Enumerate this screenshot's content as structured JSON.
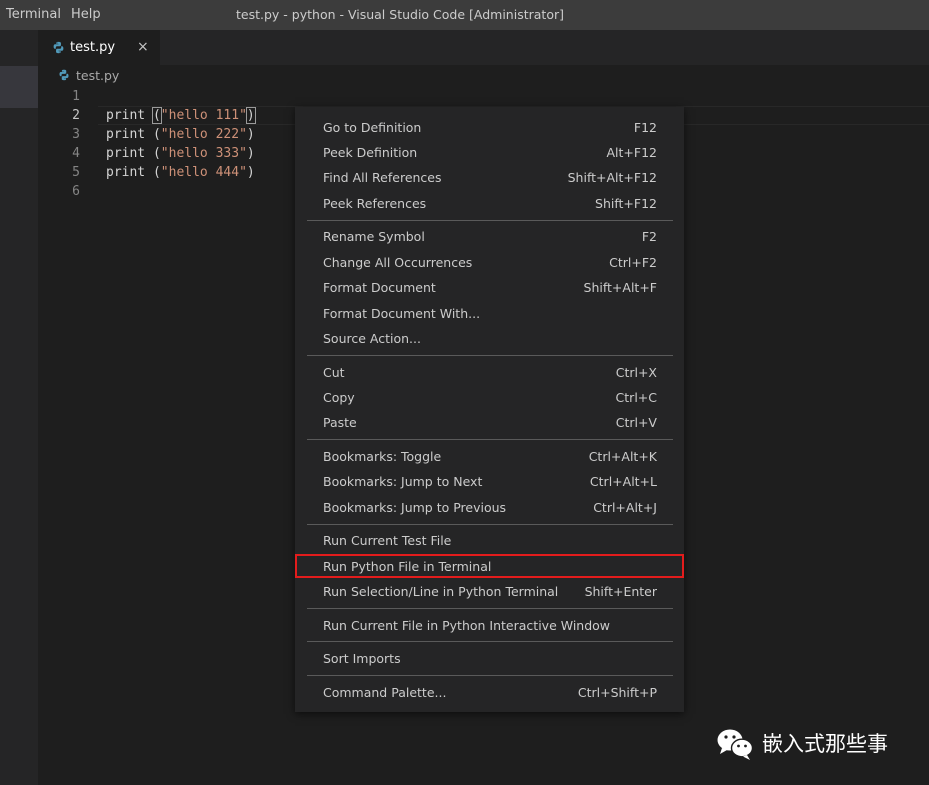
{
  "titlebar": {
    "menus": [
      "Terminal",
      "Help"
    ],
    "window_title": "test.py - python - Visual Studio Code [Administrator]"
  },
  "tab": {
    "label": "test.py",
    "close_glyph": "×",
    "icon": "python-file-icon"
  },
  "breadcrumb": {
    "label": "test.py",
    "icon": "python-file-icon"
  },
  "editor": {
    "line_numbers": [
      "1",
      "2",
      "3",
      "4",
      "5",
      "6"
    ],
    "lines": [
      {
        "fn": "",
        "str": ""
      },
      {
        "fn": "print",
        "str": "\"hello 111\""
      },
      {
        "fn": "print",
        "str": "\"hello 222\""
      },
      {
        "fn": "print",
        "str": "\"hello 333\""
      },
      {
        "fn": "print",
        "str": "\"hello 444\""
      },
      {
        "fn": "",
        "str": ""
      }
    ]
  },
  "context_menu": {
    "items": [
      {
        "label": "Go to Definition",
        "key": "F12"
      },
      {
        "label": "Peek Definition",
        "key": "Alt+F12"
      },
      {
        "label": "Find All References",
        "key": "Shift+Alt+F12"
      },
      {
        "label": "Peek References",
        "key": "Shift+F12"
      },
      {
        "label": "Rename Symbol",
        "key": "F2"
      },
      {
        "label": "Change All Occurrences",
        "key": "Ctrl+F2"
      },
      {
        "label": "Format Document",
        "key": "Shift+Alt+F"
      },
      {
        "label": "Format Document With...",
        "key": ""
      },
      {
        "label": "Source Action...",
        "key": ""
      },
      {
        "label": "Cut",
        "key": "Ctrl+X"
      },
      {
        "label": "Copy",
        "key": "Ctrl+C"
      },
      {
        "label": "Paste",
        "key": "Ctrl+V"
      },
      {
        "label": "Bookmarks: Toggle",
        "key": "Ctrl+Alt+K"
      },
      {
        "label": "Bookmarks: Jump to Next",
        "key": "Ctrl+Alt+L"
      },
      {
        "label": "Bookmarks: Jump to Previous",
        "key": "Ctrl+Alt+J"
      },
      {
        "label": "Run Current Test File",
        "key": ""
      },
      {
        "label": "Run Python File in Terminal",
        "key": ""
      },
      {
        "label": "Run Selection/Line in Python Terminal",
        "key": "Shift+Enter"
      },
      {
        "label": "Run Current File in Python Interactive Window",
        "key": ""
      },
      {
        "label": "Sort Imports",
        "key": ""
      },
      {
        "label": "Command Palette...",
        "key": "Ctrl+Shift+P"
      }
    ]
  },
  "watermark": {
    "text": "嵌入式那些事",
    "icon": "wechat-icon"
  },
  "colors": {
    "highlight": "#e31c1c",
    "string": "#ce9178",
    "menu_bg": "#252526"
  }
}
